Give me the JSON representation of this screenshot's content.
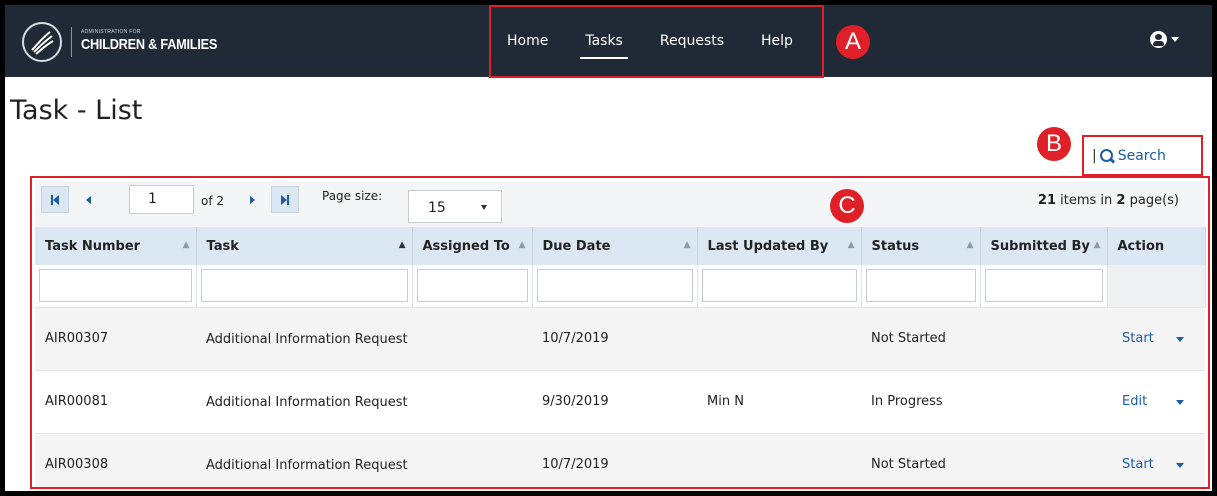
{
  "header": {
    "logo_small": "ADMINISTRATION FOR",
    "logo_main": "CHILDREN & FAMILIES",
    "nav": [
      {
        "label": "Home",
        "active": false
      },
      {
        "label": "Tasks",
        "active": true
      },
      {
        "label": "Requests",
        "active": false
      },
      {
        "label": "Help",
        "active": false
      }
    ],
    "user_icon": "user-circle-icon"
  },
  "page": {
    "title": "Task - List",
    "search_separator": "|",
    "search_label": "Search"
  },
  "annotations": {
    "a": "A",
    "b": "B",
    "c": "C"
  },
  "pager": {
    "page": "1",
    "of_label": "of 2",
    "page_size_label": "Page size:",
    "page_size": "15",
    "items_count": "21",
    "items_text": " items in ",
    "pages_count": "2",
    "pages_text": " page(s)"
  },
  "table": {
    "columns": [
      "Task Number",
      "Task",
      "Assigned To",
      "Due Date",
      "Last Updated By",
      "Status",
      "Submitted By",
      "Action"
    ],
    "rows": [
      {
        "task_number": "AIR00307",
        "task": "Additional Information Request",
        "assigned_to": "",
        "due_date": "10/7/2019",
        "last_updated_by": "",
        "status": "Not Started",
        "submitted_by": "",
        "action": "Start"
      },
      {
        "task_number": "AIR00081",
        "task": "Additional Information Request",
        "assigned_to": "",
        "due_date": "9/30/2019",
        "last_updated_by": "Min N",
        "status": "In Progress",
        "submitted_by": "",
        "action": "Edit"
      },
      {
        "task_number": "AIR00308",
        "task": "Additional Information Request",
        "assigned_to": "",
        "due_date": "10/7/2019",
        "last_updated_by": "",
        "status": "Not Started",
        "submitted_by": "",
        "action": "Start"
      }
    ]
  },
  "colors": {
    "navbar": "#1f2a36",
    "annotation": "#e02028",
    "link": "#1d5ca8",
    "header_bg": "#dbe8f3"
  }
}
